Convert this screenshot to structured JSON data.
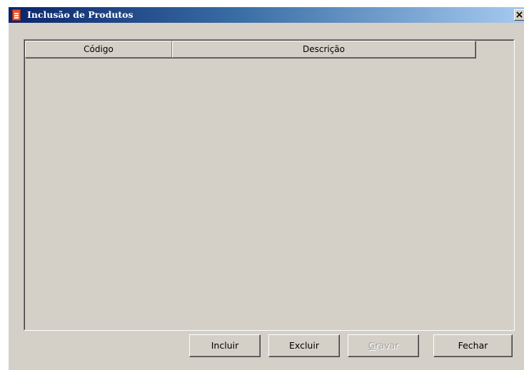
{
  "window": {
    "title": "Inclusão de Produtos",
    "close_label": "×",
    "icon": "document-icon"
  },
  "table": {
    "columns": [
      "Código",
      "Descrição"
    ],
    "rows": []
  },
  "buttons": {
    "incluir": "Incluir",
    "excluir": "Excluir",
    "gravar": "Gravar",
    "fechar": "Fechar"
  },
  "colors": {
    "titlebar_start": "#0a246a",
    "titlebar_end": "#a6caf0",
    "face": "#d4d0c8"
  }
}
